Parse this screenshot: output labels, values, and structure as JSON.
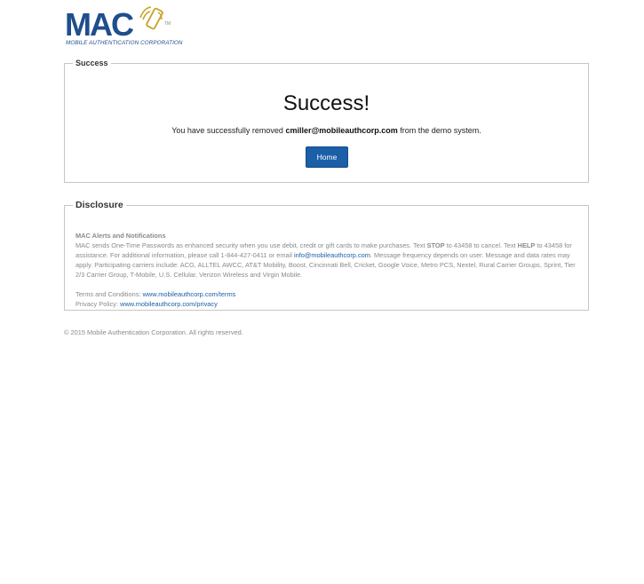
{
  "logo": {
    "wordmark": "MAC",
    "tagline": "MOBILE AUTHENTICATION CORPORATION",
    "trademark": "TM"
  },
  "success": {
    "legend": "Success",
    "heading": "Success!",
    "message_prefix": "You have successfully removed ",
    "email": "cmiller@mobileauthcorp.com",
    "message_suffix": " from the demo system.",
    "home_button": "Home"
  },
  "disclosure": {
    "legend": "Disclosure",
    "heading": "MAC Alerts and Notifications",
    "text_1": "MAC sends One-Time Passwords as enhanced security when you use debit, credit or gift cards to make purchases. Text ",
    "stop_word": "STOP",
    "text_2": " to 43458 to cancel. Text ",
    "help_word": "HELP",
    "text_3": " to 43458 for assistance. For additional information, please call 1-844-427-0411 or email ",
    "email_link": "info@mobileauthcorp.com",
    "text_4": ". Message frequency depends on user. Message and data rates may apply. Participating carriers include: ACG, ALLTEL AWCC, AT&T Mobility, Boost, Cincinnati Bell, Cricket, Google Voice, Metro PCS, Nextel, Rural Carrier Groups, Sprint, Tier 2/3 Carrier Group, T-Mobile, U.S. Cellular, Verizon Wireless and Virgin Mobile.",
    "terms_label": "Terms and Conditions: ",
    "terms_link": "www.mobileauthcorp.com/terms",
    "privacy_label": "Privacy Policy: ",
    "privacy_link": "www.mobileauthcorp.com/privacy"
  },
  "footer": {
    "copyright": "© 2015 Mobile Authentication Corporation. All rights reserved."
  },
  "colors": {
    "brand_blue": "#1f4e8c",
    "button_blue": "#1a5fa8",
    "logo_signal_gold": "#c9a227",
    "border_gray": "#c6c6c6",
    "muted_text": "#8a8a8a"
  }
}
